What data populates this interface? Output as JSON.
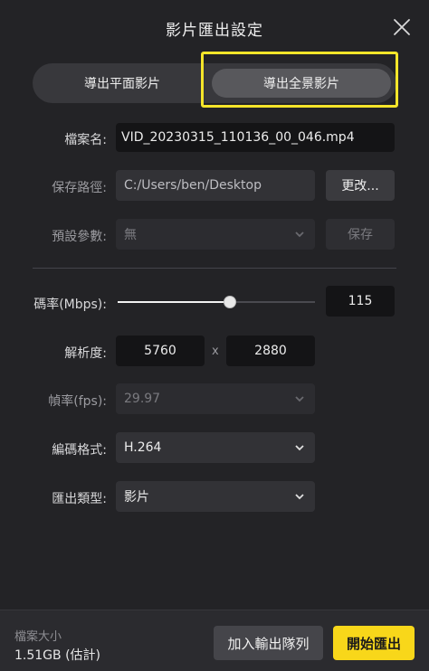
{
  "window": {
    "title": "影片匯出設定"
  },
  "colors": {
    "accent": "#f8d71a",
    "highlight_box": "#f5e52a",
    "background": "#232326"
  },
  "export_mode": {
    "options": [
      "導出平面影片",
      "導出全景影片"
    ],
    "selected": "導出全景影片"
  },
  "filename": {
    "label": "檔案名:",
    "value": "VID_20230315_110136_00_046.mp4"
  },
  "save_path": {
    "label": "保存路徑:",
    "value": "C:/Users/ben/Desktop",
    "change_label": "更改..."
  },
  "preset": {
    "label": "預設參數:",
    "value": "無",
    "save_label": "保存"
  },
  "bitrate": {
    "label": "碼率(Mbps):",
    "value": "115",
    "slider_fraction": 0.57
  },
  "resolution": {
    "label": "解析度:",
    "width": "5760",
    "separator": "x",
    "height": "2880"
  },
  "framerate": {
    "label": "幀率(fps):",
    "value": "29.97"
  },
  "codec": {
    "label": "編碼格式:",
    "value": "H.264"
  },
  "export_type": {
    "label": "匯出類型:",
    "value": "影片"
  },
  "footer": {
    "size_label": "檔案大小",
    "size_value": "1.51GB (估計)",
    "queue_button": "加入輸出隊列",
    "export_button": "開始匯出"
  }
}
